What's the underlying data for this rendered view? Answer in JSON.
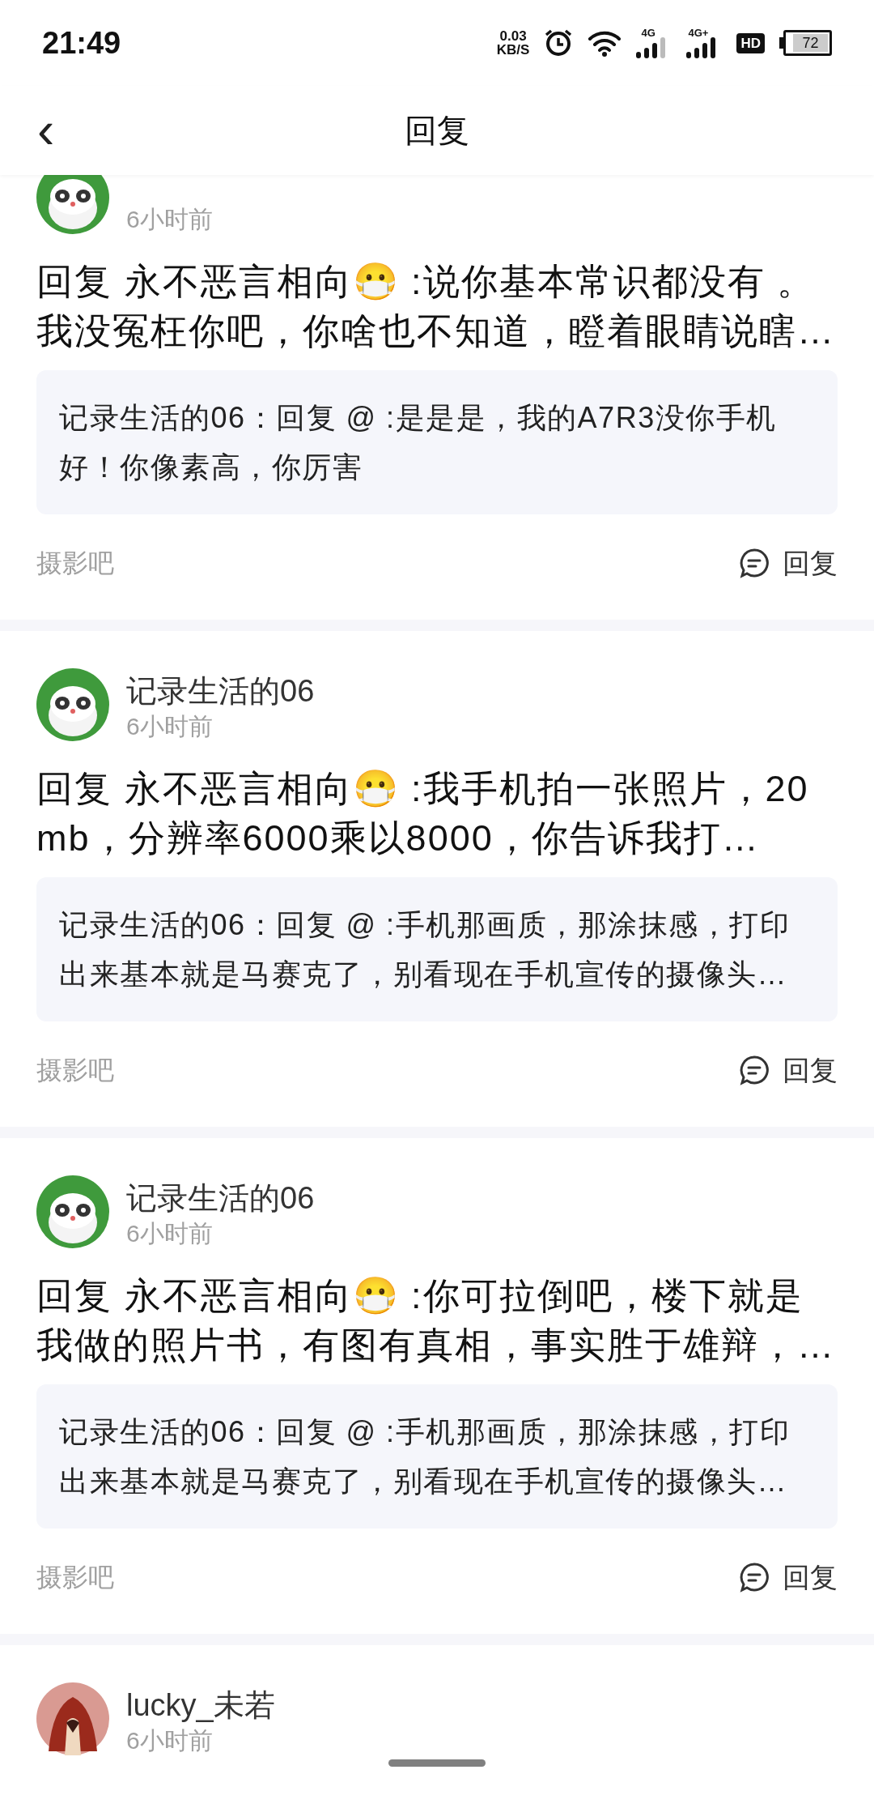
{
  "status_bar": {
    "time": "21:49",
    "net_speed_value": "0.03",
    "net_speed_unit": "KB/S",
    "signal_1_label": "4G",
    "signal_2_label": "4G+",
    "hd_label": "HD",
    "battery": "72"
  },
  "header": {
    "back": "‹",
    "title": "回复"
  },
  "posts": [
    {
      "time": "6小时前",
      "avatar": {
        "kind": "panda"
      },
      "text": "回复 永不恶言相向😷 :说你基本常识都没有 。我没冤枉你吧，你啥也不知道，瞪着眼睛说瞎…",
      "quote": "记录生活的06：回复 @ :是是是，我的A7R3没你手机好！你像素高，你厉害",
      "forum": "摄影吧",
      "reply": "回复"
    },
    {
      "name": "记录生活的06",
      "time": "6小时前",
      "avatar": {
        "kind": "panda"
      },
      "text": "回复 永不恶言相向😷 :我手机拍一张照片，20mb，分辨率6000乘以8000，你告诉我打…",
      "quote": "记录生活的06：回复 @ :手机那画质，那涂抹感，打印出来基本就是马赛克了，别看现在手机宣传的摄像头…",
      "forum": "摄影吧",
      "reply": "回复"
    },
    {
      "name": "记录生活的06",
      "time": "6小时前",
      "avatar": {
        "kind": "panda"
      },
      "text": "回复 永不恶言相向😷 :你可拉倒吧，楼下就是我做的照片书，有图有真相，事实胜于雄辩，…",
      "quote": "记录生活的06：回复 @ :手机那画质，那涂抹感，打印出来基本就是马赛克了，别看现在手机宣传的摄像头…",
      "forum": "摄影吧",
      "reply": "回复"
    },
    {
      "name": "lucky_未若",
      "time": "6小时前",
      "avatar": {
        "kind": "hood"
      }
    }
  ]
}
